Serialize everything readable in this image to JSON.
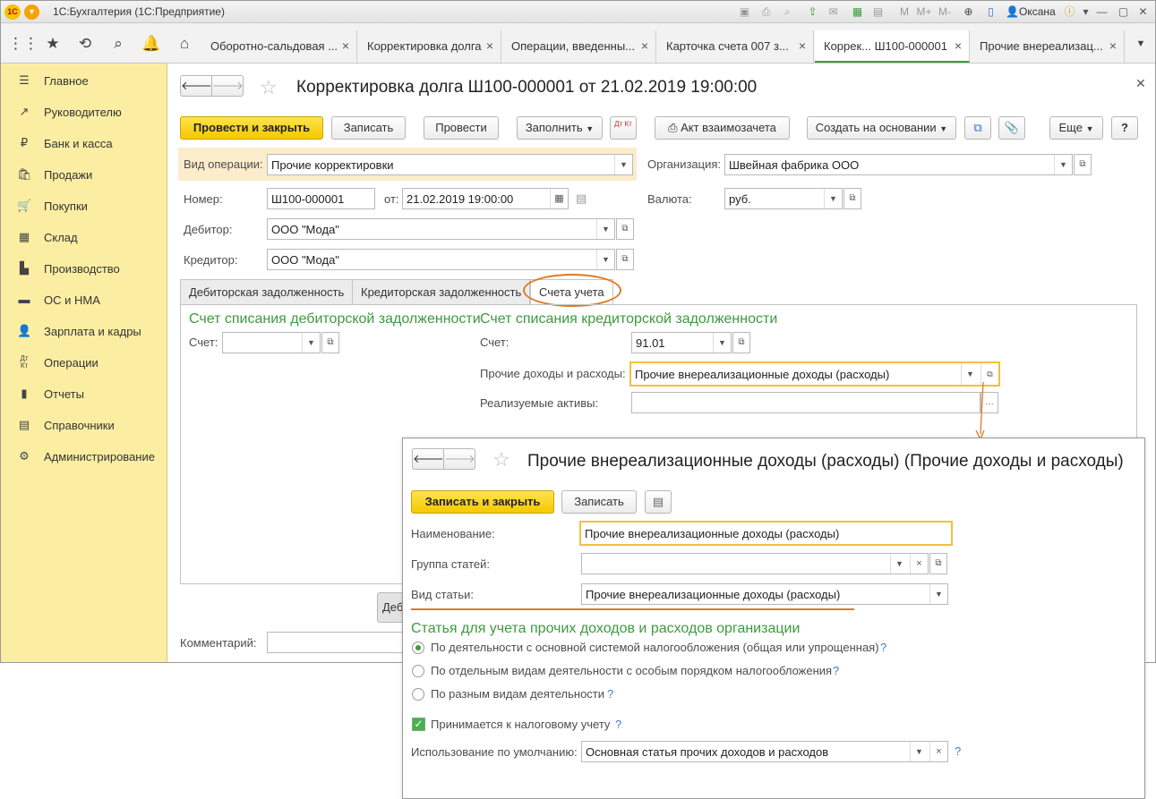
{
  "app": {
    "title": "1С:Бухгалтерия  (1С:Предприятие)",
    "logo": "1С",
    "user": "Оксана",
    "toolbar_letters": [
      "M",
      "M+",
      "M-"
    ]
  },
  "tabs": [
    {
      "label": "Оборотно-сальдовая ..."
    },
    {
      "label": "Корректировка долга"
    },
    {
      "label": "Операции, введенны..."
    },
    {
      "label": "Карточка счета 007 з..."
    },
    {
      "label": "Коррек...  Ш100-000001"
    },
    {
      "label": "Прочие внереализац..."
    }
  ],
  "sidebar": {
    "items": [
      {
        "label": "Главное",
        "icon": "menu-icon"
      },
      {
        "label": "Руководителю",
        "icon": "trend-icon"
      },
      {
        "label": "Банк и касса",
        "icon": "ruble-icon"
      },
      {
        "label": "Продажи",
        "icon": "cart-icon"
      },
      {
        "label": "Покупки",
        "icon": "basket-icon"
      },
      {
        "label": "Склад",
        "icon": "warehouse-icon"
      },
      {
        "label": "Производство",
        "icon": "factory-icon"
      },
      {
        "label": "ОС и НМА",
        "icon": "assets-icon"
      },
      {
        "label": "Зарплата и кадры",
        "icon": "person-icon"
      },
      {
        "label": "Операции",
        "icon": "dt-kt-icon"
      },
      {
        "label": "Отчеты",
        "icon": "chart-icon"
      },
      {
        "label": "Справочники",
        "icon": "book-icon"
      },
      {
        "label": "Администрирование",
        "icon": "gear-icon"
      }
    ]
  },
  "doc": {
    "title": "Корректировка долга Ш100-000001 от 21.02.2019 19:00:00",
    "buttons": {
      "post_close": "Провести и закрыть",
      "save": "Записать",
      "post": "Провести",
      "fill": "Заполнить",
      "dtkt": "Дт Кт",
      "act": "Акт взаимозачета",
      "create_based": "Создать на основании",
      "more": "Еще",
      "help": "?"
    },
    "operation_type": {
      "label": "Вид операции:",
      "value": "Прочие корректировки"
    },
    "organization": {
      "label": "Организация:",
      "value": "Швейная фабрика ООО"
    },
    "number": {
      "label": "Номер:",
      "value": "Ш100-000001"
    },
    "date": {
      "label": "от:",
      "value": "21.02.2019 19:00:00"
    },
    "currency": {
      "label": "Валюта:",
      "value": "руб."
    },
    "debtor": {
      "label": "Дебитор:",
      "value": "ООО \"Мода\""
    },
    "creditor": {
      "label": "Кредитор:",
      "value": "ООО \"Мода\""
    },
    "tabs": [
      "Дебиторская задолженность",
      "Кредиторская задолженность",
      "Счета учета"
    ],
    "debit_section": {
      "title": "Счет списания дебиторской задолженности",
      "account_label": "Счет:",
      "account_value": ""
    },
    "credit_section": {
      "title": "Счет списания кредиторской задолженности",
      "account_label": "Счет:",
      "account_value": "91.01",
      "other_label": "Прочие доходы и расходы:",
      "other_value": "Прочие внереализационные доходы (расходы)",
      "assets_label": "Реализуемые активы:",
      "assets_value": ""
    },
    "partial_button": "Деб",
    "comment_label": "Комментарий:",
    "comment_value": ""
  },
  "sub": {
    "title": "Прочие внереализационные доходы (расходы) (Прочие доходы и расходы)",
    "buttons": {
      "save_close": "Записать и закрыть",
      "save": "Записать"
    },
    "name": {
      "label": "Наименование:",
      "value": "Прочие внереализационные доходы (расходы)"
    },
    "group": {
      "label": "Группа статей:",
      "value": ""
    },
    "kind": {
      "label": "Вид статьи:",
      "value": "Прочие внереализационные доходы (расходы)"
    },
    "section_title": "Статья для учета прочих доходов и расходов организации",
    "radios": [
      {
        "label": "По деятельности с основной системой налогообложения (общая или упрощенная)",
        "selected": true
      },
      {
        "label": "По отдельным видам деятельности с особым порядком налогообложения",
        "selected": false
      },
      {
        "label": "По разным видам деятельности",
        "selected": false
      }
    ],
    "tax_check": {
      "label": "Принимается к налоговому учету",
      "checked": true
    },
    "default_use": {
      "label": "Использование по умолчанию:",
      "value": "Основная статья прочих доходов и расходов"
    },
    "help": "?"
  },
  "colors": {
    "accent_green": "#3e9a3e",
    "yellow_button": "#f5c800",
    "sidebar_bg": "#fbeea2",
    "annotation_orange": "#e07a1f"
  }
}
